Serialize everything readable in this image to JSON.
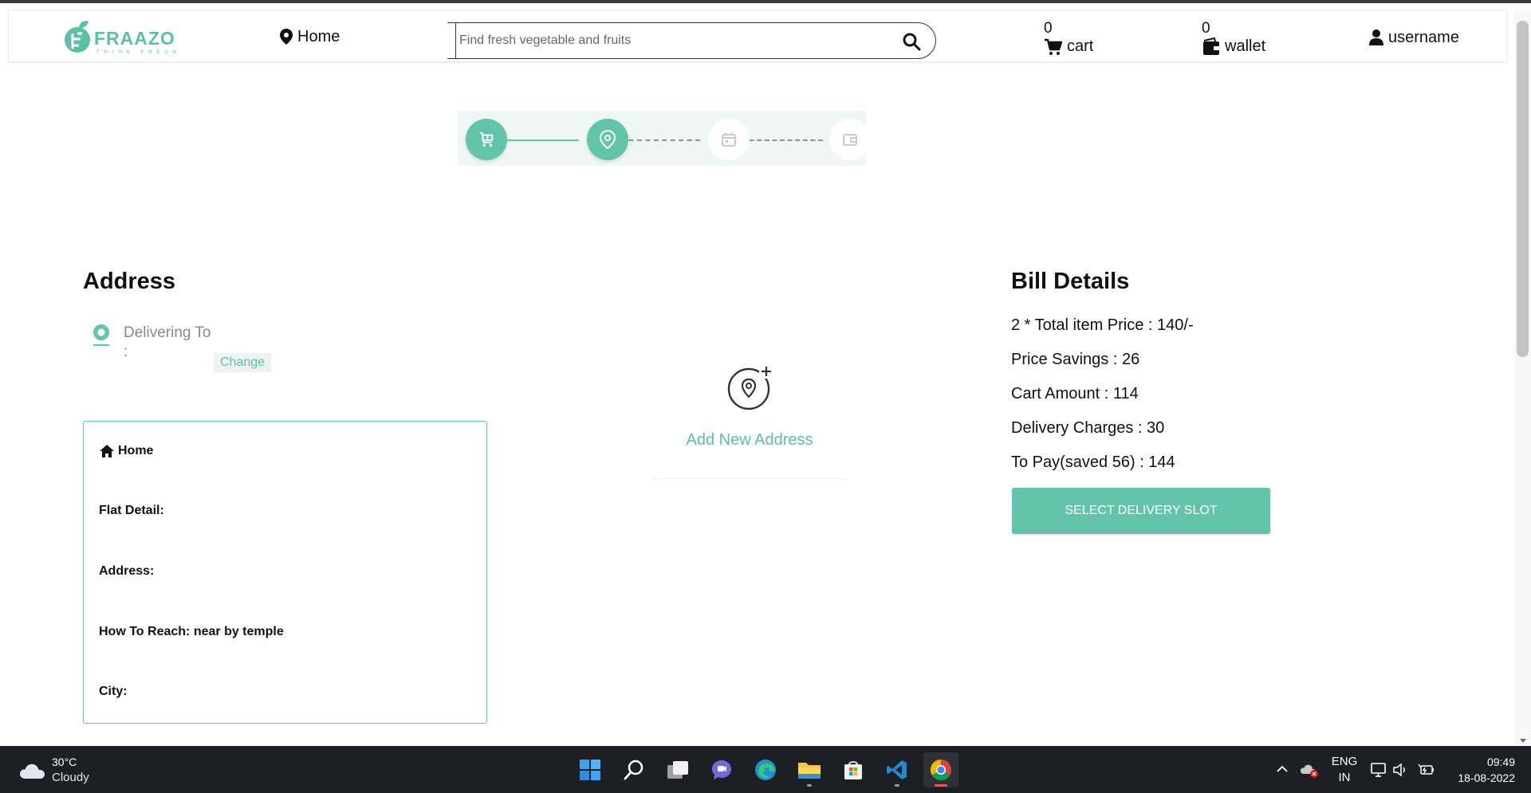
{
  "colors": {
    "accent": "#63c4ac",
    "accent_text": "#5cbfa8",
    "taskbar": "#1d1f24"
  },
  "header": {
    "logo_text": "FRAAZO",
    "logo_tagline": "THINK FRESH",
    "location": "Home",
    "search_placeholder": "Find fresh vegetable and fruits",
    "cart_count": "0",
    "cart_label": "cart",
    "wallet_count": "0",
    "wallet_label": "wallet",
    "username": "username"
  },
  "stepper": {
    "steps": [
      {
        "icon": "cart-icon",
        "state": "completed"
      },
      {
        "icon": "location-pin-icon",
        "state": "current"
      },
      {
        "icon": "calendar-icon",
        "state": "pending"
      },
      {
        "icon": "wallet-icon",
        "state": "pending"
      }
    ]
  },
  "address": {
    "title": "Address",
    "delivering_to": "Delivering To :",
    "change_label": "Change",
    "card": {
      "name": "Home",
      "flat_detail": "Flat Detail:",
      "address": "Address:",
      "how_to_reach": "How To Reach: near by temple",
      "city": "City:"
    },
    "add_new_label": "Add New Address"
  },
  "bill": {
    "title": "Bill Details",
    "lines": [
      "2 * Total item Price : 140/-",
      "Price Savings : 26",
      "Cart Amount : 114",
      "Delivery Charges : 30",
      "To Pay(saved 56) : 144"
    ],
    "button_label": "SELECT DELIVERY SLOT"
  },
  "taskbar": {
    "weather_temp": "30°C",
    "weather_desc": "Cloudy",
    "apps": [
      "windows-start-icon",
      "search-icon",
      "task-view-icon",
      "teams-chat-icon",
      "edge-icon",
      "file-explorer-icon",
      "microsoft-store-icon",
      "vscode-icon",
      "chrome-icon"
    ],
    "lang_line1": "ENG",
    "lang_line2": "IN",
    "time": "09:49",
    "date": "18-08-2022"
  }
}
